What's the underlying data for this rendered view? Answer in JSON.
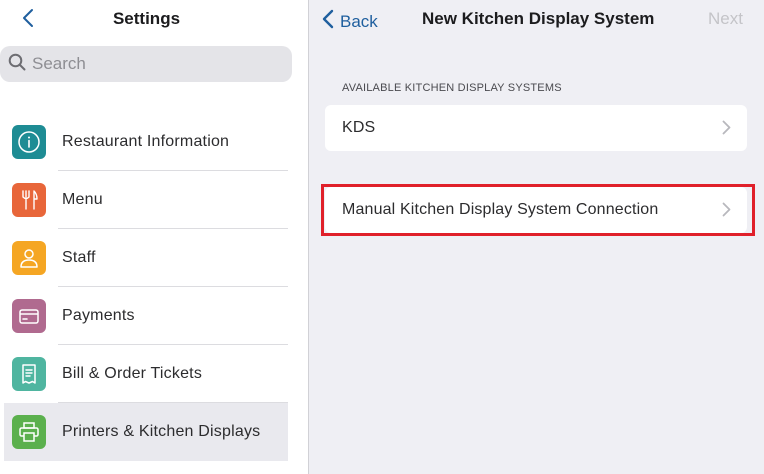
{
  "sidebar": {
    "title": "Settings",
    "search_placeholder": "Search",
    "items": [
      {
        "label": "Restaurant Information",
        "icon": "info-icon",
        "color": "#1e8c94"
      },
      {
        "label": "Menu",
        "icon": "fork-knife-icon",
        "color": "#e8663a"
      },
      {
        "label": "Staff",
        "icon": "person-icon",
        "color": "#f5a623"
      },
      {
        "label": "Payments",
        "icon": "card-icon",
        "color": "#b06a8f"
      },
      {
        "label": "Bill & Order Tickets",
        "icon": "receipt-icon",
        "color": "#4fb5a0"
      },
      {
        "label": "Printers & Kitchen Displays",
        "icon": "printer-icon",
        "color": "#5bb04d",
        "selected": true
      }
    ]
  },
  "detail": {
    "back_label": "Back",
    "title": "New Kitchen Display System",
    "next_label": "Next",
    "section_caption": "AVAILABLE KITCHEN DISPLAY SYSTEMS",
    "rows": [
      {
        "label": "KDS"
      },
      {
        "label": "Manual Kitchen Display System Connection",
        "highlighted": true
      }
    ]
  },
  "colors": {
    "accent": "#1f5f9e",
    "highlight": "#e0202a",
    "disabled": "#c4c4c8"
  }
}
